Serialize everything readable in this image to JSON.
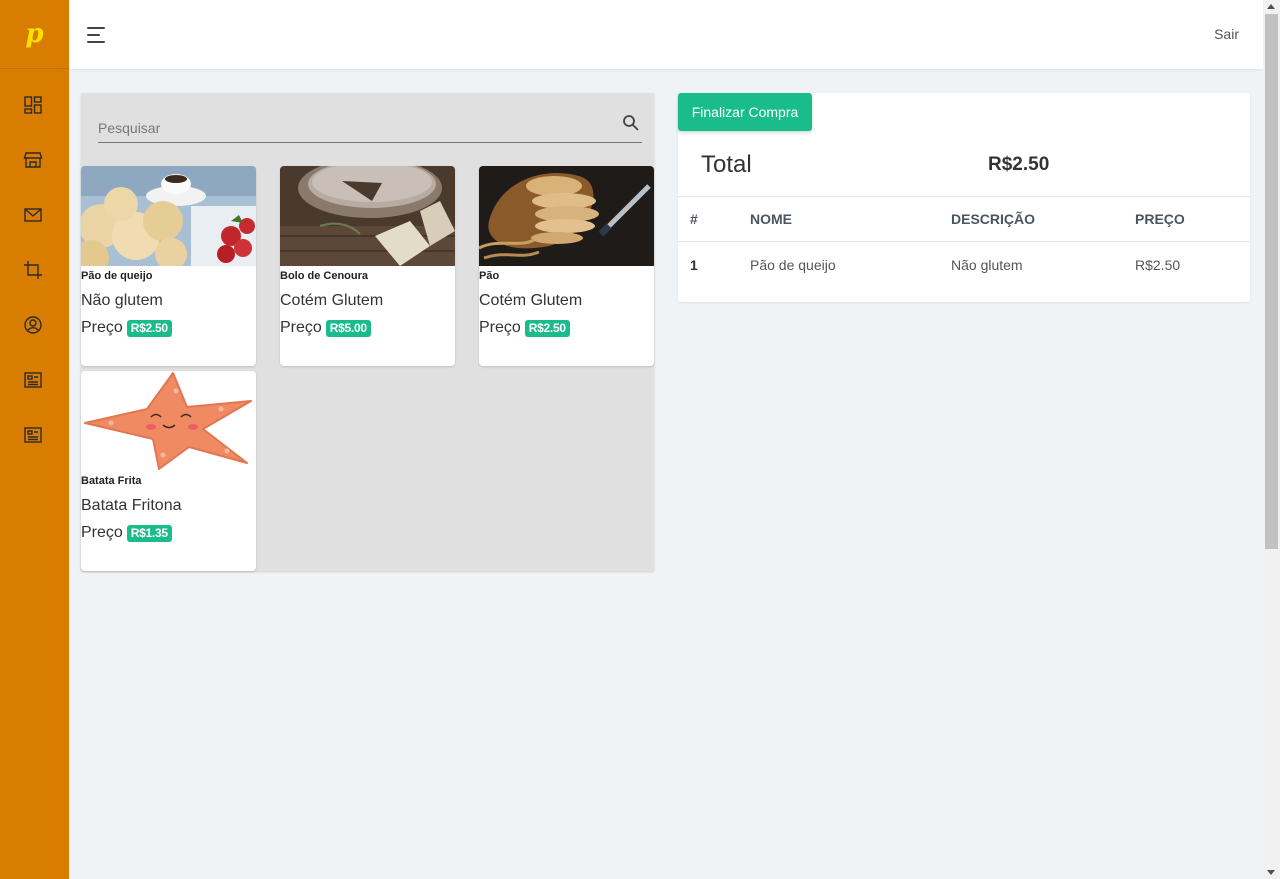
{
  "sidebar": {
    "logo": "p",
    "icons": [
      "dashboard-icon",
      "store-icon",
      "mail-icon",
      "crop-icon",
      "account-circle-icon",
      "list-alt-icon",
      "list-alt-icon"
    ]
  },
  "header": {
    "logout_label": "Sair"
  },
  "search": {
    "placeholder": "Pesquisar"
  },
  "products": [
    {
      "title": "Pão de queijo",
      "description": "Não glutem",
      "price_label": "Preço",
      "price": "R$2.50"
    },
    {
      "title": "Bolo de Cenoura",
      "description": "Cotém Glutem",
      "price_label": "Preço",
      "price": "R$5.00"
    },
    {
      "title": "Pão",
      "description": "Cotém Glutem",
      "price_label": "Preço",
      "price": "R$2.50"
    },
    {
      "title": "Batata Frita",
      "description": "Batata Fritona",
      "price_label": "Preço",
      "price": "R$1.35"
    }
  ],
  "cart": {
    "checkout_label": "Finalizar Compra",
    "total_label": "Total",
    "total_value": "R$2.50",
    "columns": [
      "#",
      "NOME",
      "DESCRIÇÃO",
      "PREÇO"
    ],
    "rows": [
      {
        "num": "1",
        "name": "Pão de queijo",
        "description": "Não glutem",
        "price": "R$2.50"
      }
    ]
  },
  "colors": {
    "sidebar": "#d97d00",
    "accent": "#1abc8c",
    "logo": "#ffe000"
  }
}
